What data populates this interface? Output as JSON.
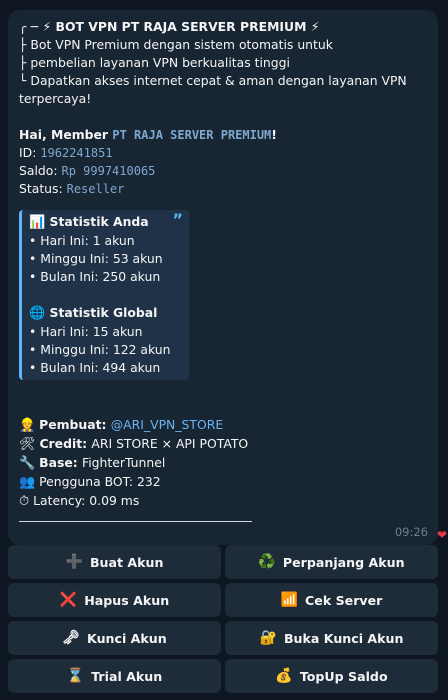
{
  "message": {
    "header": "╭ ─ ⚡ BOT VPN PT RAJA SERVER PREMIUM ⚡",
    "desc": [
      "├ Bot VPN Premium dengan sistem otomatis untuk",
      "├ pembelian layanan VPN berkualitas tinggi",
      "└ Dapatkan akses internet cepat & aman dengan layanan VPN terpercaya!"
    ],
    "greeting_prefix": "Hai, Member ",
    "greeting_name": "PT RAJA SERVER PREMIUM",
    "greeting_suffix": "!",
    "id_label": "ID: ",
    "id_value": "1962241851",
    "saldo_label": "Saldo: ",
    "saldo_value": "Rp 9997410065",
    "status_label": "Status: ",
    "status_value": "Reseller",
    "quote": {
      "stat_user_icon": "📊",
      "stat_user_title": "Statistik Anda",
      "stat_user": [
        "• Hari Ini: 1 akun",
        "• Minggu Ini: 53 akun",
        "• Bulan Ini: 250 akun"
      ],
      "stat_global_icon": "🌐",
      "stat_global_title": "Statistik Global",
      "stat_global": [
        "• Hari Ini: 15 akun",
        "• Minggu Ini: 122 akun",
        "• Bulan Ini: 494 akun"
      ],
      "quote_mark": "”"
    },
    "info": {
      "creator_icon": "👷",
      "creator_label": "Pembuat: ",
      "creator_value": "@ARI_VPN_STORE",
      "credit_icon": "🛠",
      "credit_label": "Credit: ",
      "credit_value": "ARI STORE × API POTATO",
      "base_icon": "🔧",
      "base_label": "Base: ",
      "base_value": "FighterTunnel",
      "users_icon": "👥",
      "users_text": "Pengguna BOT: 232",
      "latency_icon": "⏱",
      "latency_text": "Latency: 0.09 ms"
    },
    "time": "09:26",
    "reaction": "❤"
  },
  "keyboard": [
    [
      {
        "icon": "➕",
        "label": "Buat Akun"
      },
      {
        "icon": "♻️",
        "label": "Perpanjang Akun"
      }
    ],
    [
      {
        "icon": "❌",
        "label": "Hapus Akun"
      },
      {
        "icon": "📶",
        "label": "Cek Server"
      }
    ],
    [
      {
        "icon": "🗝",
        "label": "Kunci Akun"
      },
      {
        "icon": "🔐",
        "label": "Buka Kunci Akun"
      }
    ],
    [
      {
        "icon": "⌛",
        "label": "Trial Akun"
      },
      {
        "icon": "💰",
        "label": "TopUp Saldo"
      }
    ]
  ]
}
